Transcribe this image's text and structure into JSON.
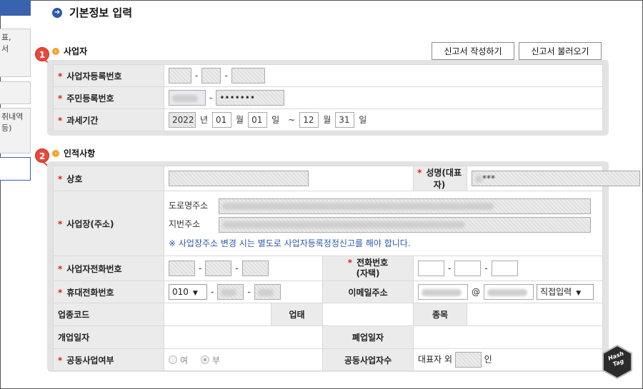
{
  "sidebar": {
    "box1_text": "표,\n서",
    "box3_text": "취내역\n등)"
  },
  "page_title": "기본정보 입력",
  "buttons": {
    "write_report": "신고서 작성하기",
    "load_report": "신고서 불러오기"
  },
  "section1": {
    "badge": "1",
    "title": "사업자",
    "rows": {
      "bizno_label": "사업자등록번호",
      "resident_label": "주민등록번호",
      "resident_masked": "•••••••",
      "period_label": "과세기간",
      "year": "2022",
      "year_unit": "년",
      "start_month": "01",
      "month_unit": "월",
      "start_day": "01",
      "day_unit": "일",
      "tilde": "~",
      "end_month": "12",
      "end_day": "31"
    }
  },
  "section2": {
    "badge": "2",
    "title": "인적사항",
    "rows": {
      "trade_name_label": "상호",
      "rep_name_label": "성명(대표자)",
      "rep_name_value": "***",
      "address_label": "사업장(주소)",
      "road_address_label": "도로명주소",
      "lot_address_label": "지번주소",
      "address_note": "※ 사업장주소 변경 시는 별도로 사업자등록정정신고를 해야 합니다.",
      "biz_phone_label": "사업자전화번호",
      "home_phone_label": "전화번호\n(자택)",
      "mobile_label": "휴대전화번호",
      "mobile_prefix": "010",
      "email_label": "이메일주소",
      "email_at": "@",
      "email_domain_select": "직접입력",
      "industry_code_label": "업종코드",
      "business_type_label": "업태",
      "business_item_label": "종목",
      "open_date_label": "개업일자",
      "close_date_label": "폐업일자",
      "joint_business_label": "공동사업여부",
      "joint_yes": "여",
      "joint_no": "부",
      "joint_count_label": "공동사업자수",
      "rep_except_text": "대표자 외",
      "person_unit": "인"
    }
  },
  "logo_text": "Hash\nTag",
  "colors": {
    "accent_blue": "#2a5ba8",
    "required_red": "#d22222",
    "badge_red": "#e8483b",
    "section_icon_orange": "#f4a32a"
  }
}
